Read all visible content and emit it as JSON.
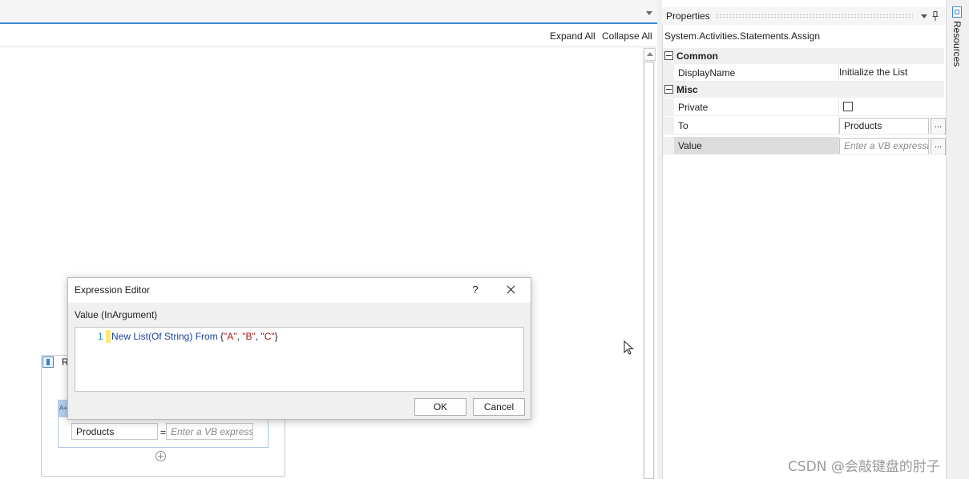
{
  "designer": {
    "expand_all": "Expand All",
    "collapse_all": "Collapse All",
    "sequence_title": "R",
    "assign": {
      "icon_label": "A+",
      "to_value": "Products",
      "equals": "=",
      "value_placeholder": "Enter a VB expressi"
    }
  },
  "expression_editor": {
    "title": "Expression Editor",
    "help": "?",
    "argument_label": "Value (InArgument)",
    "line_number": "1",
    "code": {
      "kw1": "New List(Of String) From ",
      "brace_open": "{",
      "s1": "\"A\"",
      "sep1": ", ",
      "s2": "\"B\"",
      "sep2": ", ",
      "s3": "\"C\"",
      "brace_close": "}"
    },
    "ok_label": "OK",
    "cancel_label": "Cancel"
  },
  "properties": {
    "title": "Properties",
    "type_name": "System.Activities.Statements.Assign",
    "categories": {
      "common": "Common",
      "misc": "Misc"
    },
    "rows": {
      "display_name": {
        "name": "DisplayName",
        "value": "Initialize the List"
      },
      "private": {
        "name": "Private"
      },
      "to": {
        "name": "To",
        "value": "Products",
        "btn": "..."
      },
      "value": {
        "name": "Value",
        "placeholder": "Enter a VB expressio",
        "btn": "..."
      }
    }
  },
  "side_tab": {
    "resources": "Resources"
  },
  "watermark": "CSDN @会敲键盘的肘子",
  "colors": {
    "accent": "#3d87d6",
    "keyword": "#1a3fa0",
    "string": "#a31515"
  }
}
